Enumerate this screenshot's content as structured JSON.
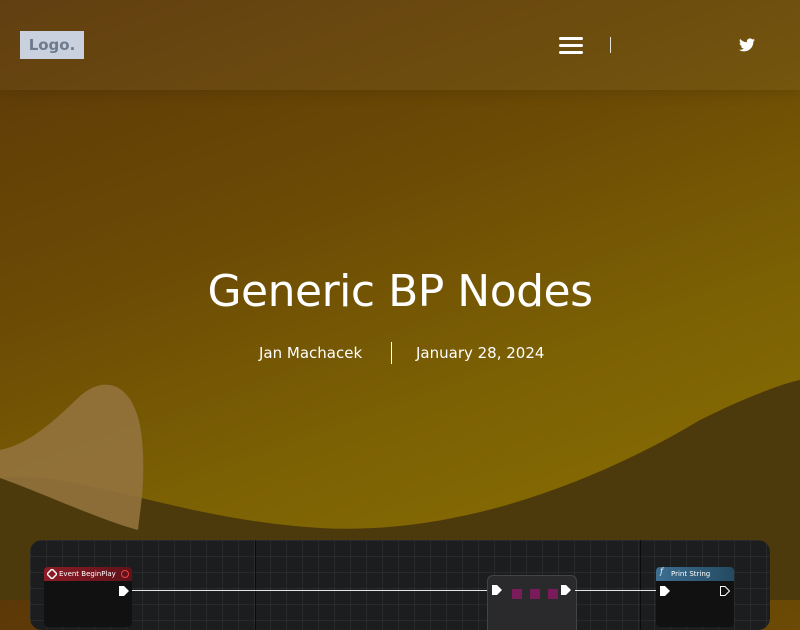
{
  "header": {
    "logo_text": "Logo.",
    "menu_icon": "hamburger-menu-icon",
    "social_icon": "twitter-icon"
  },
  "hero": {
    "title": "Generic BP Nodes",
    "author": "Jan Machacek",
    "date": "January 28, 2024"
  },
  "blueprint": {
    "begin_node_title": "Event BeginPlay",
    "print_node_title": "Print String"
  },
  "colors": {
    "bg_start": "#5c3808",
    "bg_end": "#8c7102",
    "logo_bg": "#c8d1dd",
    "wave_dark": "#4d3a0c",
    "wave_light": "#93733d",
    "event_node": "#8d1c26",
    "function_node": "#3d6f91",
    "panel_bg": "#1c1d1f"
  }
}
